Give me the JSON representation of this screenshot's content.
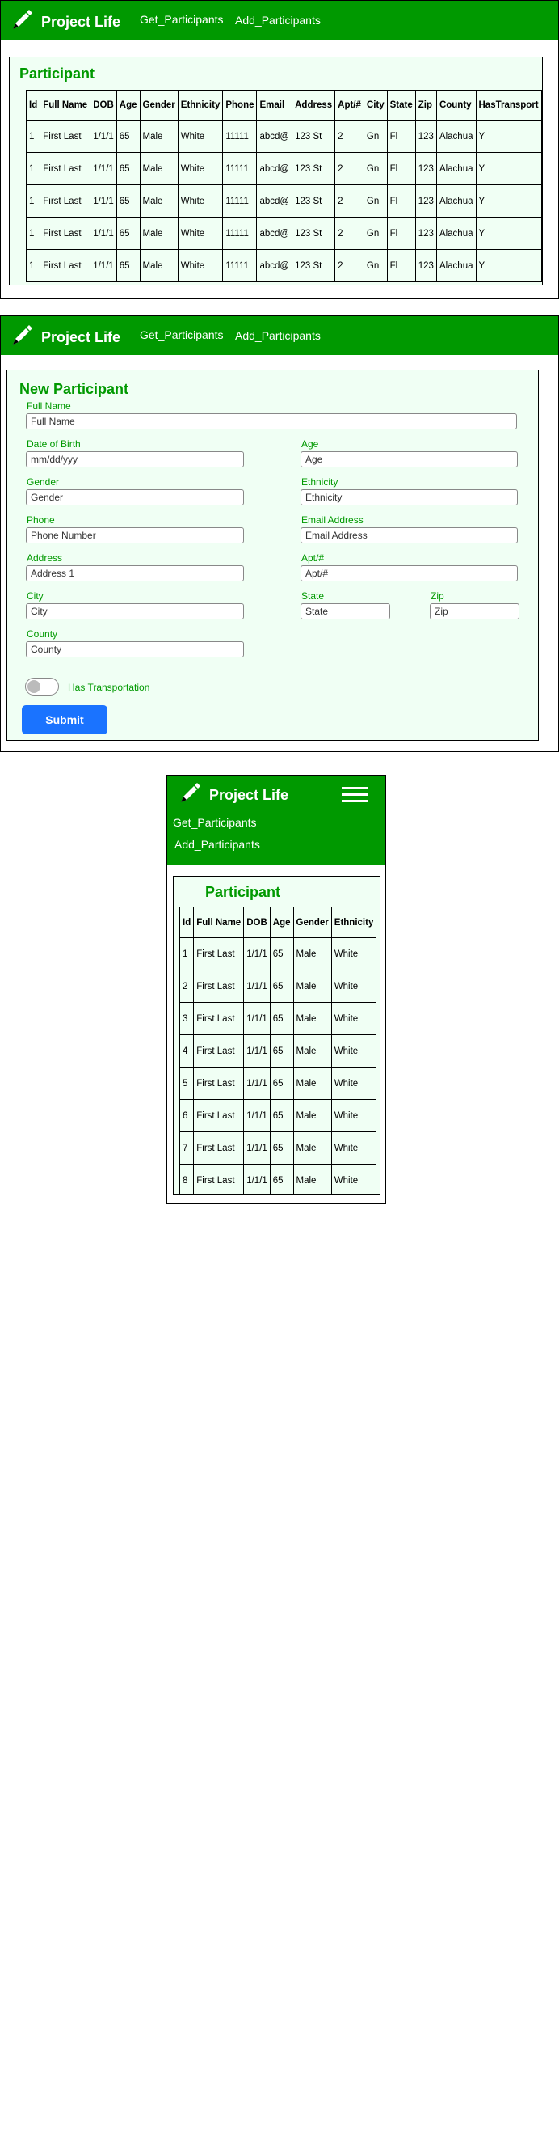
{
  "app": {
    "brand_name": "Project Life",
    "nav_links": [
      "Get_Participants",
      "Add_Participants"
    ],
    "icons": {
      "brand": "pen-icon",
      "menu": "hamburger-menu-icon"
    },
    "colors": {
      "nav": "#009900",
      "accent_text": "#009900",
      "card_bg": "#f0fff4",
      "submit": "#1a73ff"
    }
  },
  "participants_view": {
    "title": "Participant",
    "columns": [
      "Id",
      "Full Name",
      "DOB",
      "Age",
      "Gender",
      "Ethnicity",
      "Phone",
      "Email",
      "Address",
      "Apt/#",
      "City",
      "State",
      "Zip",
      "County",
      "HasTransport"
    ],
    "rows": [
      [
        "1",
        "First Last",
        "1/1/1",
        "65",
        "Male",
        "White",
        "11111",
        "abcd@",
        "123 St",
        "2",
        "Gn",
        "Fl",
        "123",
        "Alachua",
        "Y"
      ],
      [
        "1",
        "First Last",
        "1/1/1",
        "65",
        "Male",
        "White",
        "11111",
        "abcd@",
        "123 St",
        "2",
        "Gn",
        "Fl",
        "123",
        "Alachua",
        "Y"
      ],
      [
        "1",
        "First Last",
        "1/1/1",
        "65",
        "Male",
        "White",
        "11111",
        "abcd@",
        "123 St",
        "2",
        "Gn",
        "Fl",
        "123",
        "Alachua",
        "Y"
      ],
      [
        "1",
        "First Last",
        "1/1/1",
        "65",
        "Male",
        "White",
        "11111",
        "abcd@",
        "123 St",
        "2",
        "Gn",
        "Fl",
        "123",
        "Alachua",
        "Y"
      ],
      [
        "1",
        "First Last",
        "1/1/1",
        "65",
        "Male",
        "White",
        "11111",
        "abcd@",
        "123 St",
        "2",
        "Gn",
        "Fl",
        "123",
        "Alachua",
        "Y"
      ]
    ]
  },
  "new_participant_form": {
    "title": "New Participant",
    "fields": {
      "full_name": {
        "label": "Full Name",
        "placeholder": "Full Name"
      },
      "dob": {
        "label": "Date of Birth",
        "placeholder": "mm/dd/yyy"
      },
      "age": {
        "label": "Age",
        "placeholder": "Age"
      },
      "gender": {
        "label": "Gender",
        "placeholder": "Gender"
      },
      "ethnicity": {
        "label": "Ethnicity",
        "placeholder": "Ethnicity"
      },
      "phone": {
        "label": "Phone",
        "placeholder": "Phone Number"
      },
      "email": {
        "label": "Email Address",
        "placeholder": "Email Address"
      },
      "address": {
        "label": "Address",
        "placeholder": "Address 1"
      },
      "apt": {
        "label": "Apt/#",
        "placeholder": "Apt/#"
      },
      "city": {
        "label": "City",
        "placeholder": "City"
      },
      "state": {
        "label": "State",
        "placeholder": "State"
      },
      "zip": {
        "label": "Zip",
        "placeholder": "Zip"
      },
      "county": {
        "label": "County",
        "placeholder": "County"
      }
    },
    "transport_toggle": {
      "label": "Has Transportation",
      "checked": false
    },
    "submit_label": "Submit"
  },
  "mobile_view": {
    "title": "Participant",
    "columns": [
      "Id",
      "Full Name",
      "DOB",
      "Age",
      "Gender",
      "Ethnicity"
    ],
    "rows": [
      [
        "1",
        "First Last",
        "1/1/1",
        "65",
        "Male",
        "White"
      ],
      [
        "2",
        "First Last",
        "1/1/1",
        "65",
        "Male",
        "White"
      ],
      [
        "3",
        "First Last",
        "1/1/1",
        "65",
        "Male",
        "White"
      ],
      [
        "4",
        "First Last",
        "1/1/1",
        "65",
        "Male",
        "White"
      ],
      [
        "5",
        "First Last",
        "1/1/1",
        "65",
        "Male",
        "White"
      ],
      [
        "6",
        "First Last",
        "1/1/1",
        "65",
        "Male",
        "White"
      ],
      [
        "7",
        "First Last",
        "1/1/1",
        "65",
        "Male",
        "White"
      ],
      [
        "8",
        "First Last",
        "1/1/1",
        "65",
        "Male",
        "White"
      ]
    ]
  }
}
